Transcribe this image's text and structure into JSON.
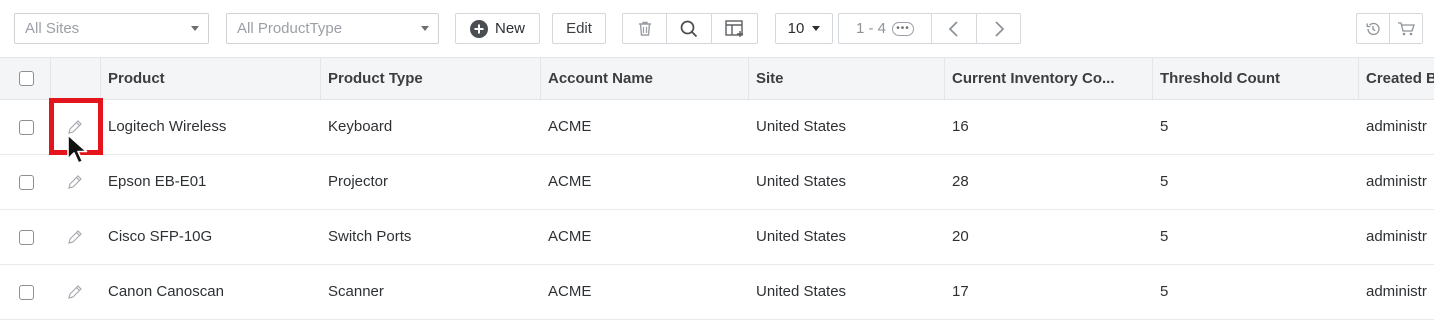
{
  "toolbar": {
    "sites_select": "All Sites",
    "product_type_select": "All ProductType",
    "new_label": "New",
    "edit_label": "Edit",
    "page_size": "10",
    "page_range": "1 - 4"
  },
  "table": {
    "columns": [
      "Product",
      "Product Type",
      "Account Name",
      "Site",
      "Current Inventory Co...",
      "Threshold Count",
      "Created B"
    ],
    "rows": [
      [
        "Logitech Wireless",
        "Keyboard",
        "ACME",
        "United States",
        "16",
        "5",
        "administr"
      ],
      [
        "Epson EB-E01",
        "Projector",
        "ACME",
        "United States",
        "28",
        "5",
        "administr"
      ],
      [
        "Cisco SFP-10G",
        "Switch Ports",
        "ACME",
        "United States",
        "20",
        "5",
        "administr"
      ],
      [
        "Canon Canoscan",
        "Scanner",
        "ACME",
        "United States",
        "17",
        "5",
        "administr"
      ]
    ]
  },
  "colors": {
    "highlight": "#e4141c",
    "header_bg": "#f4f5f6",
    "border": "#e3e5e8"
  },
  "icons": [
    "plus-circle-icon",
    "trash-icon",
    "search-icon",
    "columns-icon",
    "chevron-left-icon",
    "chevron-right-icon",
    "history-icon",
    "cart-icon",
    "pencil-icon",
    "mouse-cursor-icon"
  ]
}
